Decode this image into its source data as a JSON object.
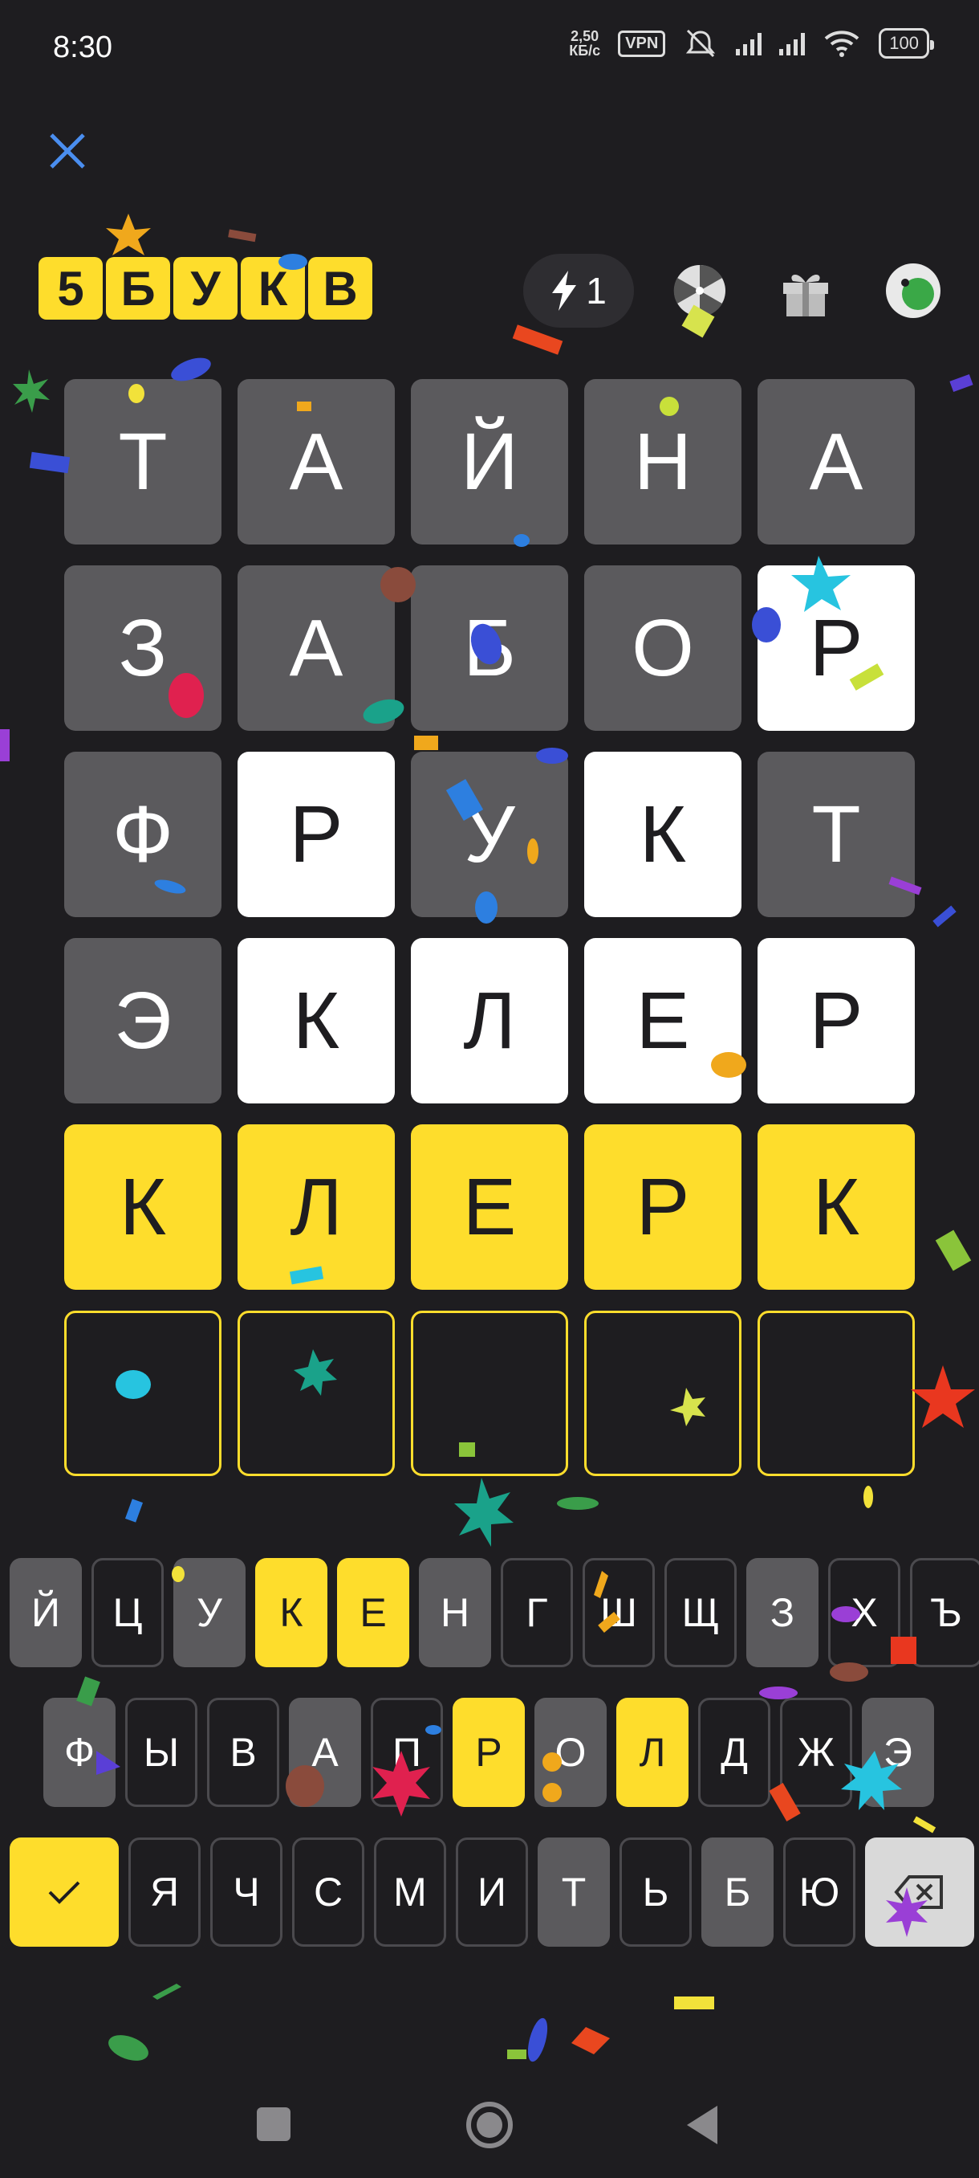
{
  "status_bar": {
    "time": "8:30",
    "speed_value": "2,50",
    "speed_unit": "КБ/с",
    "vpn": "VPN",
    "battery": "100"
  },
  "header": {
    "logo_letters": [
      "5",
      "Б",
      "У",
      "К",
      "В"
    ],
    "energy_count": "1"
  },
  "board": {
    "rows": [
      [
        {
          "l": "Т",
          "s": "absent"
        },
        {
          "l": "А",
          "s": "absent"
        },
        {
          "l": "Й",
          "s": "absent"
        },
        {
          "l": "Н",
          "s": "absent"
        },
        {
          "l": "А",
          "s": "absent"
        }
      ],
      [
        {
          "l": "З",
          "s": "absent"
        },
        {
          "l": "А",
          "s": "absent"
        },
        {
          "l": "Б",
          "s": "absent"
        },
        {
          "l": "О",
          "s": "absent"
        },
        {
          "l": "Р",
          "s": "present"
        }
      ],
      [
        {
          "l": "Ф",
          "s": "absent"
        },
        {
          "l": "Р",
          "s": "present"
        },
        {
          "l": "У",
          "s": "absent"
        },
        {
          "l": "К",
          "s": "present"
        },
        {
          "l": "Т",
          "s": "absent"
        }
      ],
      [
        {
          "l": "Э",
          "s": "absent"
        },
        {
          "l": "К",
          "s": "present"
        },
        {
          "l": "Л",
          "s": "present"
        },
        {
          "l": "Е",
          "s": "present"
        },
        {
          "l": "Р",
          "s": "present"
        }
      ],
      [
        {
          "l": "К",
          "s": "correct"
        },
        {
          "l": "Л",
          "s": "correct"
        },
        {
          "l": "Е",
          "s": "correct"
        },
        {
          "l": "Р",
          "s": "correct"
        },
        {
          "l": "К",
          "s": "correct"
        }
      ],
      [
        {
          "l": "",
          "s": "empty"
        },
        {
          "l": "",
          "s": "empty"
        },
        {
          "l": "",
          "s": "empty"
        },
        {
          "l": "",
          "s": "empty"
        },
        {
          "l": "",
          "s": "empty"
        }
      ]
    ]
  },
  "keyboard": {
    "row1": [
      {
        "l": "Й",
        "s": "absent"
      },
      {
        "l": "Ц",
        "s": "unused"
      },
      {
        "l": "У",
        "s": "absent"
      },
      {
        "l": "К",
        "s": "present"
      },
      {
        "l": "Е",
        "s": "present"
      },
      {
        "l": "Н",
        "s": "absent"
      },
      {
        "l": "Г",
        "s": "unused"
      },
      {
        "l": "Ш",
        "s": "unused"
      },
      {
        "l": "Щ",
        "s": "unused"
      },
      {
        "l": "З",
        "s": "absent"
      },
      {
        "l": "Х",
        "s": "unused"
      },
      {
        "l": "Ъ",
        "s": "unused"
      }
    ],
    "row2": [
      {
        "l": "Ф",
        "s": "absent"
      },
      {
        "l": "Ы",
        "s": "unused"
      },
      {
        "l": "В",
        "s": "unused"
      },
      {
        "l": "А",
        "s": "absent"
      },
      {
        "l": "П",
        "s": "unused"
      },
      {
        "l": "Р",
        "s": "present"
      },
      {
        "l": "О",
        "s": "absent"
      },
      {
        "l": "Л",
        "s": "present"
      },
      {
        "l": "Д",
        "s": "unused"
      },
      {
        "l": "Ж",
        "s": "unused"
      },
      {
        "l": "Э",
        "s": "absent"
      }
    ],
    "row3": [
      {
        "l": "Я",
        "s": "unused"
      },
      {
        "l": "Ч",
        "s": "unused"
      },
      {
        "l": "С",
        "s": "unused"
      },
      {
        "l": "М",
        "s": "unused"
      },
      {
        "l": "И",
        "s": "unused"
      },
      {
        "l": "Т",
        "s": "absent"
      },
      {
        "l": "Ь",
        "s": "unused"
      },
      {
        "l": "Б",
        "s": "absent"
      },
      {
        "l": "Ю",
        "s": "unused"
      }
    ]
  },
  "icons": {
    "close": "close-icon",
    "energy": "lightning-icon",
    "wheel": "fortune-wheel-icon",
    "gift": "gift-icon",
    "profile": "avatar-icon",
    "enter": "checkmark-icon",
    "backspace": "backspace-icon"
  },
  "colors": {
    "background": "#1e1d20",
    "correct": "#fedd2c",
    "present": "#ffffff",
    "absent": "#5b5a5d",
    "accent_close": "#4a8ef0"
  }
}
